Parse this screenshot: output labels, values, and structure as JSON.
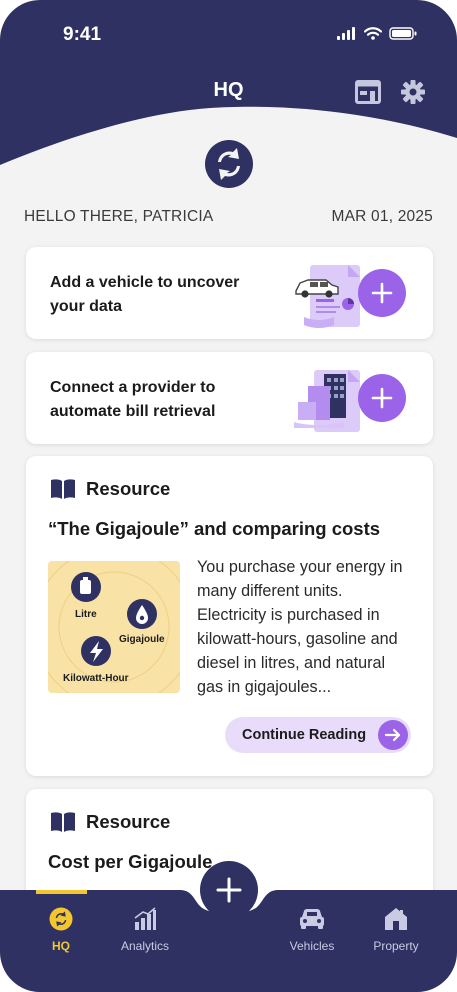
{
  "status_bar": {
    "time": "9:41"
  },
  "header": {
    "title": "HQ"
  },
  "greeting": {
    "hello": "HELLO THERE, PATRICIA",
    "date": "MAR 01, 2025"
  },
  "cards": {
    "vehicle": {
      "text": "Add a vehicle to uncover your data"
    },
    "provider": {
      "text": "Connect a provider to automate bill retrieval"
    }
  },
  "resources": [
    {
      "label": "Resource",
      "title": "“The Gigajoule” and comparing costs",
      "thumbnail_labels": {
        "litre": "Litre",
        "gigajoule": "Gigajoule",
        "kilowatt_hour": "Kilowatt-Hour"
      },
      "body": "You purchase your energy in many different units. Electricity is purchased in kilowatt-hours, gasoline and diesel in litres, and natural gas in gigajoules...",
      "cta": "Continue Reading"
    },
    {
      "label": "Resource",
      "title": "Cost per Gigajoule"
    }
  ],
  "bottom_nav": [
    {
      "label": "HQ",
      "icon": "hq-icon",
      "active": true
    },
    {
      "label": "Analytics",
      "icon": "analytics-icon",
      "active": false
    },
    {
      "label": "Vehicles",
      "icon": "car-icon",
      "active": false
    },
    {
      "label": "Property",
      "icon": "house-icon",
      "active": false
    }
  ],
  "colors": {
    "navy": "#2f3162",
    "purple": "#9a63e8",
    "light_purple": "#e9dcfb",
    "yellow": "#f3c52f",
    "background": "#f3f3f3"
  }
}
